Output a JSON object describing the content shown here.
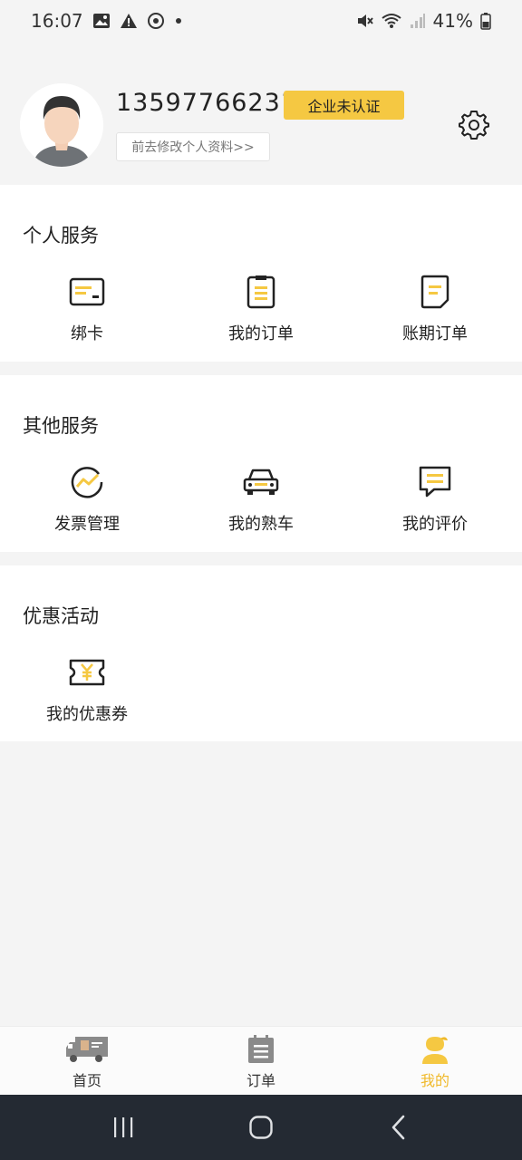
{
  "status_bar": {
    "time": "16:07",
    "battery": "41%"
  },
  "profile": {
    "phone": "13597766231",
    "cert_badge": "企业未认证",
    "edit_link": "前去修改个人资料>>"
  },
  "sections": {
    "personal": {
      "title": "个人服务",
      "items": [
        {
          "label": "绑卡",
          "icon": "card-icon"
        },
        {
          "label": "我的订单",
          "icon": "order-list-icon"
        },
        {
          "label": "账期订单",
          "icon": "period-order-icon"
        }
      ]
    },
    "other": {
      "title": "其他服务",
      "items": [
        {
          "label": "发票管理",
          "icon": "invoice-chart-icon"
        },
        {
          "label": "我的熟车",
          "icon": "car-icon"
        },
        {
          "label": "我的评价",
          "icon": "review-icon"
        }
      ]
    },
    "promo": {
      "title": "优惠活动",
      "items": [
        {
          "label": "我的优惠券",
          "icon": "coupon-icon"
        }
      ]
    }
  },
  "bottom_nav": {
    "items": [
      {
        "label": "首页",
        "icon": "truck-icon"
      },
      {
        "label": "订单",
        "icon": "clipboard-icon"
      },
      {
        "label": "我的",
        "icon": "user-icon",
        "active": true
      }
    ]
  },
  "colors": {
    "accent": "#f5c842",
    "active_text": "#f0b92a",
    "page_bg": "#f4f4f4",
    "system_nav_bg": "#242a33"
  }
}
